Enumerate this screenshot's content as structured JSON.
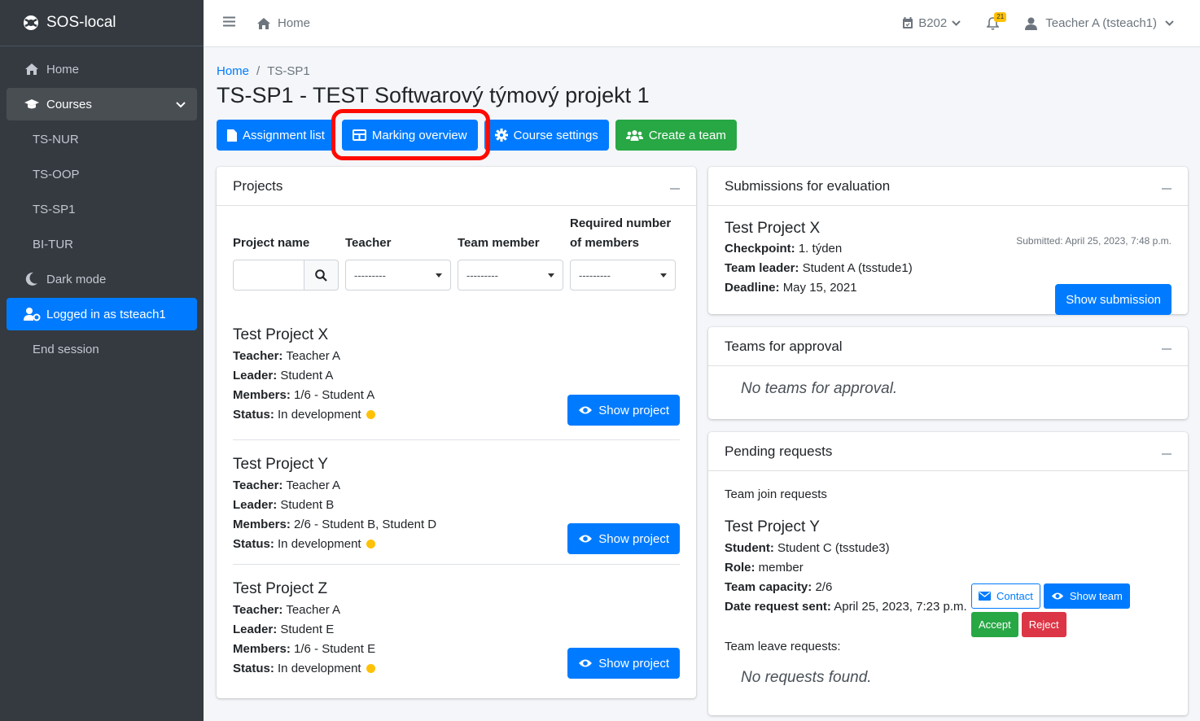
{
  "sidebar": {
    "brand": "SOS-local",
    "items": [
      {
        "label": "Home"
      },
      {
        "label": "Courses"
      },
      {
        "label": "TS-NUR"
      },
      {
        "label": "TS-OOP"
      },
      {
        "label": "TS-SP1"
      },
      {
        "label": "BI-TUR"
      },
      {
        "label": "Dark mode"
      },
      {
        "label": "Logged in as tsteach1"
      },
      {
        "label": "End session"
      }
    ]
  },
  "topbar": {
    "home": "Home",
    "room": "B202",
    "notifications": "21",
    "user": "Teacher A (tsteach1)"
  },
  "breadcrumb": {
    "home": "Home",
    "current": "TS-SP1"
  },
  "page_title": "TS-SP1 - TEST Softwarový týmový projekt 1",
  "buttons": {
    "assignment_list": "Assignment list",
    "marking_overview": "Marking overview",
    "course_settings": "Course settings",
    "create_team": "Create a team"
  },
  "projects_card": {
    "title": "Projects",
    "filters": {
      "project_name": "Project name",
      "teacher": "Teacher",
      "team_member": "Team member",
      "required": "Required number of members",
      "placeholder": "---------"
    },
    "labels": {
      "teacher": "Teacher:",
      "leader": "Leader:",
      "members": "Members:",
      "status": "Status:"
    },
    "show_project": "Show project",
    "projects": [
      {
        "name": "Test Project X",
        "teacher": "Teacher A",
        "leader": "Student A",
        "members": "1/6 - Student A",
        "status": "In development"
      },
      {
        "name": "Test Project Y",
        "teacher": "Teacher A",
        "leader": "Student B",
        "members": "2/6 - Student B, Student D",
        "status": "In development"
      },
      {
        "name": "Test Project Z",
        "teacher": "Teacher A",
        "leader": "Student E",
        "members": "1/6 - Student E",
        "status": "In development"
      }
    ]
  },
  "submissions_card": {
    "title": "Submissions for evaluation",
    "project": "Test Project X",
    "submitted": "Submitted: April 25, 2023, 7:48 p.m.",
    "checkpoint_label": "Checkpoint:",
    "checkpoint": "1. týden",
    "leader_label": "Team leader:",
    "leader": "Student A (tsstude1)",
    "deadline_label": "Deadline:",
    "deadline": "May 15, 2021",
    "button": "Show submission"
  },
  "approval_card": {
    "title": "Teams for approval",
    "empty": "No teams for approval."
  },
  "requests_card": {
    "title": "Pending requests",
    "join_title": "Team join requests",
    "project": "Test Project Y",
    "student_label": "Student:",
    "student": "Student C (tsstude3)",
    "role_label": "Role:",
    "role": "member",
    "capacity_label": "Team capacity:",
    "capacity": "2/6",
    "date_label": "Date request sent:",
    "date": "April 25, 2023, 7:23 p.m.",
    "contact": "Contact",
    "show_team": "Show team",
    "accept": "Accept",
    "reject": "Reject",
    "leave_title": "Team leave requests:",
    "empty": "No requests found."
  }
}
